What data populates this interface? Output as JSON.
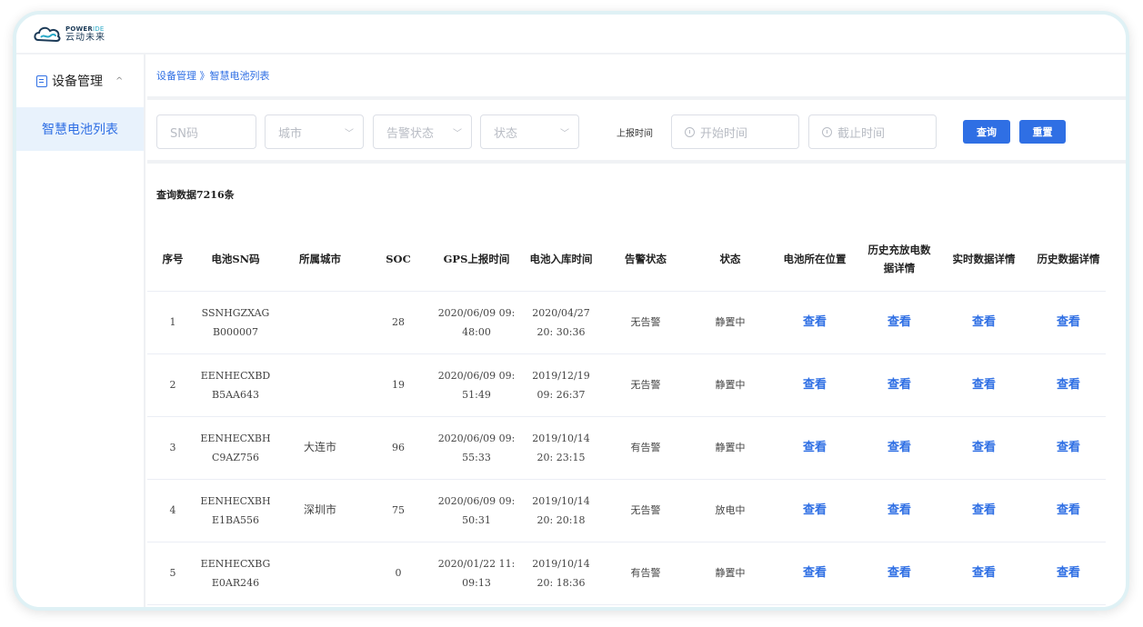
{
  "logo": {
    "en_a": "POWER",
    "en_b": "IDE",
    "cn": "云动未来",
    "colors": {
      "dark": "#1b3a57",
      "accent": "#2aa9c7"
    }
  },
  "sidebar": {
    "menu_label": "设备管理",
    "menu_icon": "device-list-icon",
    "chevron": "^",
    "items": [
      {
        "label": "智慧电池列表",
        "active": true
      }
    ]
  },
  "breadcrumb": "设备管理 》智慧电池列表",
  "filters": {
    "sn_placeholder": "SN码",
    "city_placeholder": "城市",
    "alarm_placeholder": "告警状态",
    "status_placeholder": "状态",
    "time_label": "上报时间",
    "start_placeholder": "开始时间",
    "end_placeholder": "截止时间",
    "search_label": "查询",
    "reset_label": "重置"
  },
  "result_count": "查询数据7216条",
  "table": {
    "columns": [
      "序号",
      "电池SN码",
      "所属城市",
      "SOC",
      "GPS上报时间",
      "电池入库时间",
      "告警状态",
      "状态",
      "电池所在位置",
      "历史充放电数据详情",
      "实时数据详情",
      "历史数据详情"
    ],
    "rows": [
      {
        "no": "1",
        "sn": "SSNHGZXAG B000007",
        "city": "",
        "soc": "28",
        "gps": "2020/06/09 09: 48:00",
        "stock": "2020/04/27 20: 30:36",
        "alarm": "无告警",
        "status": "静置中"
      },
      {
        "no": "2",
        "sn": "EENHECXBD B5AA643",
        "city": "",
        "soc": "19",
        "gps": "2020/06/09 09: 51:49",
        "stock": "2019/12/19 09: 26:37",
        "alarm": "无告警",
        "status": "静置中"
      },
      {
        "no": "3",
        "sn": "EENHECXBH C9AZ756",
        "city": "大连市",
        "soc": "96",
        "gps": "2020/06/09 09: 55:33",
        "stock": "2019/10/14 20: 23:15",
        "alarm": "有告警",
        "status": "静置中"
      },
      {
        "no": "4",
        "sn": "EENHECXBH E1BA556",
        "city": "深圳市",
        "soc": "75",
        "gps": "2020/06/09 09: 50:31",
        "stock": "2019/10/14 20: 20:18",
        "alarm": "无告警",
        "status": "放电中"
      },
      {
        "no": "5",
        "sn": "EENHECXBG E0AR246",
        "city": "",
        "soc": "0",
        "gps": "2020/01/22 11: 09:13",
        "stock": "2019/10/14 20: 18:36",
        "alarm": "有告警",
        "status": "静置中"
      }
    ],
    "view_label": "查看"
  },
  "colors": {
    "primary": "#2f6fe4",
    "active_bg": "#e8f2fc",
    "frame": "#dff1f5"
  }
}
